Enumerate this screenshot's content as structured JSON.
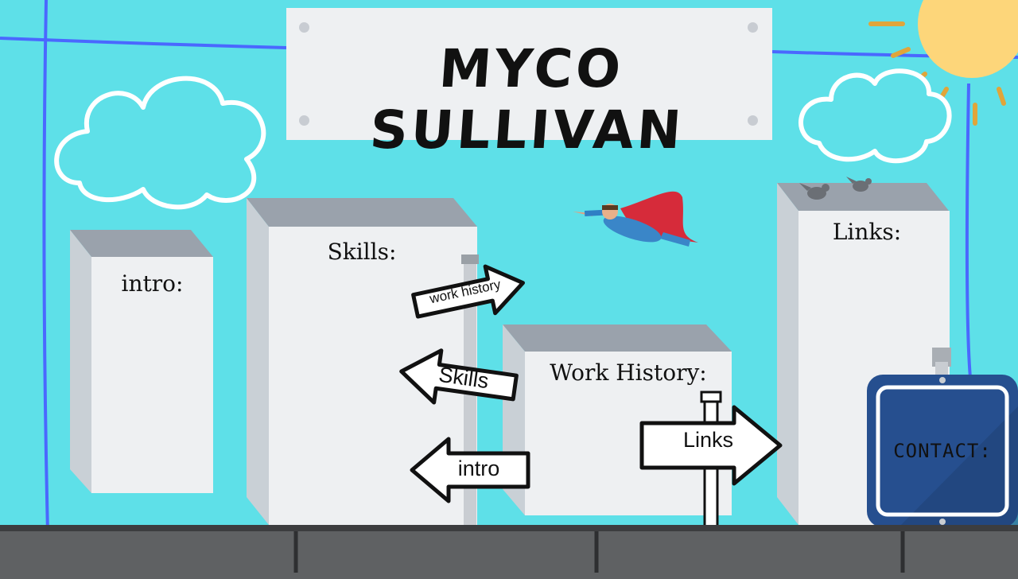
{
  "header": {
    "title": "MYCO SULLIVAN"
  },
  "buildings": {
    "intro_label": "intro:",
    "skills_label": "Skills:",
    "work_label": "Work History:",
    "links_label": "Links:"
  },
  "signpost": {
    "work_history": "work history",
    "skills": "Skills",
    "intro": "intro",
    "links": "Links"
  },
  "contact": {
    "label": "CONTACT:"
  },
  "colors": {
    "sky": "#5ee0e8",
    "sun": "#fdd67a",
    "contact_sign": "#264f8f",
    "cape": "#d62b3a"
  }
}
